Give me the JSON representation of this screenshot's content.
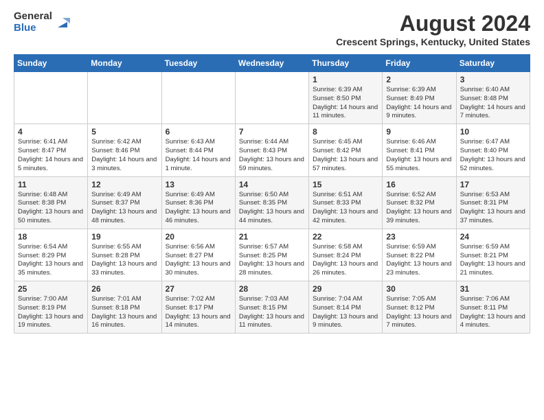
{
  "logo": {
    "general": "General",
    "blue": "Blue"
  },
  "title": "August 2024",
  "subtitle": "Crescent Springs, Kentucky, United States",
  "days_of_week": [
    "Sunday",
    "Monday",
    "Tuesday",
    "Wednesday",
    "Thursday",
    "Friday",
    "Saturday"
  ],
  "weeks": [
    [
      {
        "day": "",
        "info": ""
      },
      {
        "day": "",
        "info": ""
      },
      {
        "day": "",
        "info": ""
      },
      {
        "day": "",
        "info": ""
      },
      {
        "day": "1",
        "info": "Sunrise: 6:39 AM\nSunset: 8:50 PM\nDaylight: 14 hours and 11 minutes."
      },
      {
        "day": "2",
        "info": "Sunrise: 6:39 AM\nSunset: 8:49 PM\nDaylight: 14 hours and 9 minutes."
      },
      {
        "day": "3",
        "info": "Sunrise: 6:40 AM\nSunset: 8:48 PM\nDaylight: 14 hours and 7 minutes."
      }
    ],
    [
      {
        "day": "4",
        "info": "Sunrise: 6:41 AM\nSunset: 8:47 PM\nDaylight: 14 hours and 5 minutes."
      },
      {
        "day": "5",
        "info": "Sunrise: 6:42 AM\nSunset: 8:46 PM\nDaylight: 14 hours and 3 minutes."
      },
      {
        "day": "6",
        "info": "Sunrise: 6:43 AM\nSunset: 8:44 PM\nDaylight: 14 hours and 1 minute."
      },
      {
        "day": "7",
        "info": "Sunrise: 6:44 AM\nSunset: 8:43 PM\nDaylight: 13 hours and 59 minutes."
      },
      {
        "day": "8",
        "info": "Sunrise: 6:45 AM\nSunset: 8:42 PM\nDaylight: 13 hours and 57 minutes."
      },
      {
        "day": "9",
        "info": "Sunrise: 6:46 AM\nSunset: 8:41 PM\nDaylight: 13 hours and 55 minutes."
      },
      {
        "day": "10",
        "info": "Sunrise: 6:47 AM\nSunset: 8:40 PM\nDaylight: 13 hours and 52 minutes."
      }
    ],
    [
      {
        "day": "11",
        "info": "Sunrise: 6:48 AM\nSunset: 8:38 PM\nDaylight: 13 hours and 50 minutes."
      },
      {
        "day": "12",
        "info": "Sunrise: 6:49 AM\nSunset: 8:37 PM\nDaylight: 13 hours and 48 minutes."
      },
      {
        "day": "13",
        "info": "Sunrise: 6:49 AM\nSunset: 8:36 PM\nDaylight: 13 hours and 46 minutes."
      },
      {
        "day": "14",
        "info": "Sunrise: 6:50 AM\nSunset: 8:35 PM\nDaylight: 13 hours and 44 minutes."
      },
      {
        "day": "15",
        "info": "Sunrise: 6:51 AM\nSunset: 8:33 PM\nDaylight: 13 hours and 42 minutes."
      },
      {
        "day": "16",
        "info": "Sunrise: 6:52 AM\nSunset: 8:32 PM\nDaylight: 13 hours and 39 minutes."
      },
      {
        "day": "17",
        "info": "Sunrise: 6:53 AM\nSunset: 8:31 PM\nDaylight: 13 hours and 37 minutes."
      }
    ],
    [
      {
        "day": "18",
        "info": "Sunrise: 6:54 AM\nSunset: 8:29 PM\nDaylight: 13 hours and 35 minutes."
      },
      {
        "day": "19",
        "info": "Sunrise: 6:55 AM\nSunset: 8:28 PM\nDaylight: 13 hours and 33 minutes."
      },
      {
        "day": "20",
        "info": "Sunrise: 6:56 AM\nSunset: 8:27 PM\nDaylight: 13 hours and 30 minutes."
      },
      {
        "day": "21",
        "info": "Sunrise: 6:57 AM\nSunset: 8:25 PM\nDaylight: 13 hours and 28 minutes."
      },
      {
        "day": "22",
        "info": "Sunrise: 6:58 AM\nSunset: 8:24 PM\nDaylight: 13 hours and 26 minutes."
      },
      {
        "day": "23",
        "info": "Sunrise: 6:59 AM\nSunset: 8:22 PM\nDaylight: 13 hours and 23 minutes."
      },
      {
        "day": "24",
        "info": "Sunrise: 6:59 AM\nSunset: 8:21 PM\nDaylight: 13 hours and 21 minutes."
      }
    ],
    [
      {
        "day": "25",
        "info": "Sunrise: 7:00 AM\nSunset: 8:19 PM\nDaylight: 13 hours and 19 minutes."
      },
      {
        "day": "26",
        "info": "Sunrise: 7:01 AM\nSunset: 8:18 PM\nDaylight: 13 hours and 16 minutes."
      },
      {
        "day": "27",
        "info": "Sunrise: 7:02 AM\nSunset: 8:17 PM\nDaylight: 13 hours and 14 minutes."
      },
      {
        "day": "28",
        "info": "Sunrise: 7:03 AM\nSunset: 8:15 PM\nDaylight: 13 hours and 11 minutes."
      },
      {
        "day": "29",
        "info": "Sunrise: 7:04 AM\nSunset: 8:14 PM\nDaylight: 13 hours and 9 minutes."
      },
      {
        "day": "30",
        "info": "Sunrise: 7:05 AM\nSunset: 8:12 PM\nDaylight: 13 hours and 7 minutes."
      },
      {
        "day": "31",
        "info": "Sunrise: 7:06 AM\nSunset: 8:11 PM\nDaylight: 13 hours and 4 minutes."
      }
    ]
  ]
}
